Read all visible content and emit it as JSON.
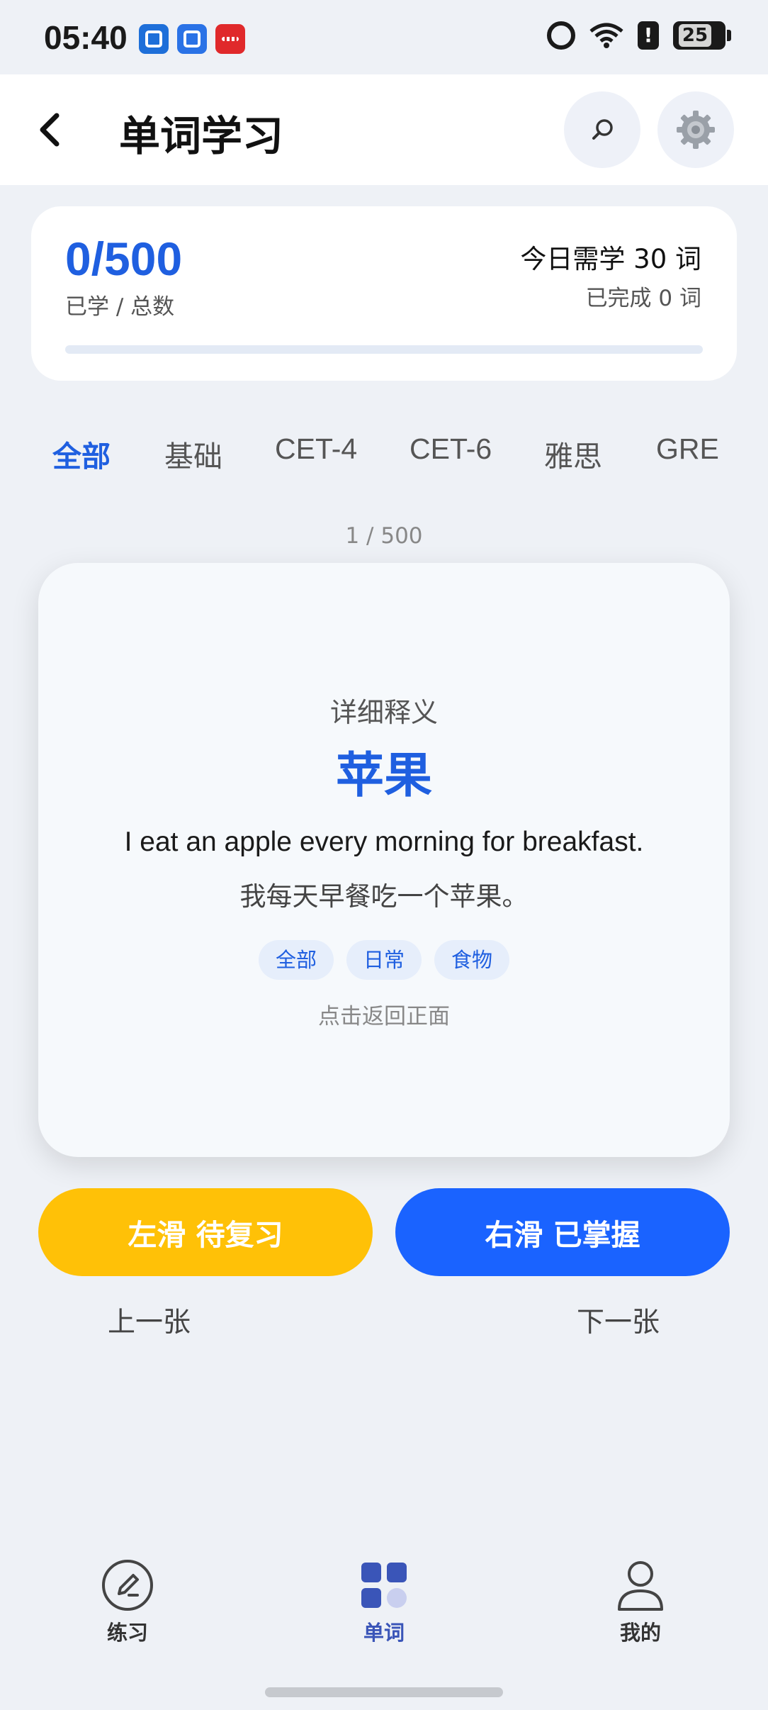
{
  "status_bar": {
    "time": "05:40",
    "battery": "25",
    "warning_glyph": "!",
    "icons": [
      "app-badge-blue-icon",
      "app-badge-blue2-icon",
      "app-badge-red-icon",
      "alarm-icon",
      "wifi-icon",
      "warning-icon",
      "battery-icon"
    ]
  },
  "header": {
    "title": "单词学习",
    "back_icon": "chevron-left-icon",
    "search_icon": "search-icon",
    "settings_icon": "gear-icon"
  },
  "progress": {
    "count": "0/500",
    "learned": 0,
    "total": 500,
    "sub_label": "已学 / 总数",
    "today_goal": "今日需学 30 词",
    "today_done": "已完成 0 词"
  },
  "tabs": [
    {
      "label": "全部",
      "active": true
    },
    {
      "label": "基础",
      "active": false
    },
    {
      "label": "CET-4",
      "active": false
    },
    {
      "label": "CET-6",
      "active": false
    },
    {
      "label": "雅思",
      "active": false
    },
    {
      "label": "GRE",
      "active": false
    }
  ],
  "card": {
    "index": "1 / 500",
    "detail_label": "详细释义",
    "meaning": "苹果",
    "example_en": "I eat an apple every morning for breakfast.",
    "example_zh": "我每天早餐吃一个苹果。",
    "tags": [
      "全部",
      "日常",
      "食物"
    ],
    "flip_hint": "点击返回正面"
  },
  "actions": {
    "review_label": "左滑 待复习",
    "mastered_label": "右滑 已掌握",
    "prev_label": "上一张",
    "next_label": "下一张"
  },
  "bottom_nav": [
    {
      "label": "练习",
      "icon": "pencil-circle-icon",
      "active": false
    },
    {
      "label": "单词",
      "icon": "grid-icon",
      "active": true
    },
    {
      "label": "我的",
      "icon": "user-icon",
      "active": false
    }
  ],
  "colors": {
    "accent": "#1f5fe0",
    "review": "#ffc107",
    "mastered": "#1a63ff",
    "background": "#eef1f6"
  }
}
